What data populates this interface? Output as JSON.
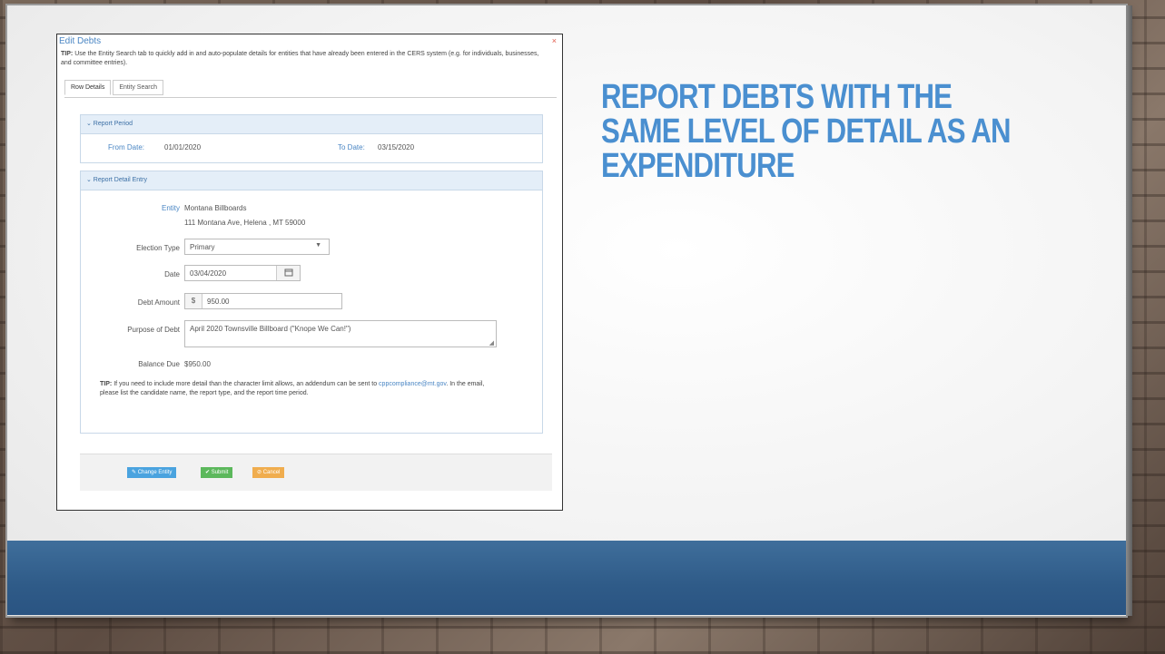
{
  "slide": {
    "headline": "REPORT DEBTS WITH THE\nSAME LEVEL OF DETAIL AS AN\nEXPENDITURE"
  },
  "modal": {
    "title": "Edit Debts",
    "close": "×",
    "tip_label": "TIP:",
    "tip_text": "Use the Entity Search tab to quickly add in and auto-populate details for entities that have already been entered in the CERS system (e.g. for individuals, businesses, and committee entries).",
    "tabs": [
      "Row Details",
      "Entity Search"
    ],
    "report_period": {
      "heading": "⌄  Report Period",
      "from_label": "From Date:",
      "from_value": "01/01/2020",
      "to_label": "To Date:",
      "to_value": "03/15/2020"
    },
    "detail": {
      "heading": "⌄  Report Detail Entry",
      "entity_label": "Entity",
      "entity_name": "Montana Billboards",
      "entity_address": "111 Montana Ave, Helena , MT 59000",
      "election_type_label": "Election Type",
      "election_type_value": "Primary",
      "date_label": "Date",
      "date_value": "03/04/2020",
      "debt_amount_label": "Debt Amount",
      "currency": "$",
      "debt_amount_value": "950.00",
      "purpose_label": "Purpose of Debt",
      "purpose_value": "April 2020 Townsville Billboard (\"Knope We Can!\")",
      "balance_label": "Balance Due",
      "balance_value": "$950.00"
    },
    "tip2_label": "TIP:",
    "tip2_a": "If you need to include more detail than the character limit allows, an addendum can be sent to",
    "tip2_email": "cppcompliance@mt.gov",
    "tip2_b": ". In the email, please list the candidate name, the report type, and the report time period.",
    "buttons": {
      "change_entity": "Change Entity",
      "submit": "Submit",
      "cancel": "Cancel"
    }
  },
  "colors": {
    "accent": "#4a86c4",
    "headline": "#4a8fd0",
    "change_btn": "#4aa3df",
    "submit_btn": "#5cb85c",
    "cancel_btn": "#f0ad4e",
    "bar": "#2f5b88"
  },
  "icons": {
    "dropdown": "caret-down-icon",
    "calendar": "calendar-icon",
    "change": "edit-icon",
    "submit": "check-icon",
    "cancel": "ban-icon"
  }
}
